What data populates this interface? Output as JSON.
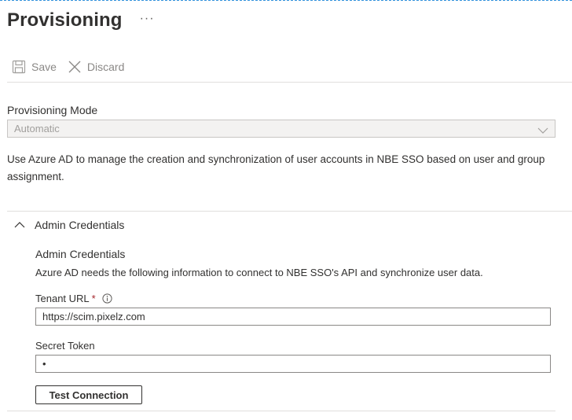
{
  "header": {
    "title": "Provisioning",
    "more_label": "···"
  },
  "toolbar": {
    "save_label": "Save",
    "discard_label": "Discard",
    "save_icon": "save-icon",
    "discard_icon": "close-icon"
  },
  "provisioning_mode": {
    "label": "Provisioning Mode",
    "value": "Automatic",
    "disabled": true
  },
  "description": "Use Azure AD to manage the creation and synchronization of user accounts in NBE SSO based on user and group assignment.",
  "admin_credentials": {
    "section_label": "Admin Credentials",
    "expanded": true,
    "subtitle": "Admin Credentials",
    "subtitle_desc": "Azure AD needs the following information to connect to NBE SSO's API and synchronize user data.",
    "tenant_url": {
      "label": "Tenant URL",
      "required_mark": "*",
      "value": "https://scim.pixelz.com"
    },
    "secret_token": {
      "label": "Secret Token",
      "value": "•"
    },
    "test_button_label": "Test Connection"
  },
  "colors": {
    "accent": "#0078d4",
    "required": "#a4262c",
    "disabled_bg": "#f3f2f1"
  }
}
